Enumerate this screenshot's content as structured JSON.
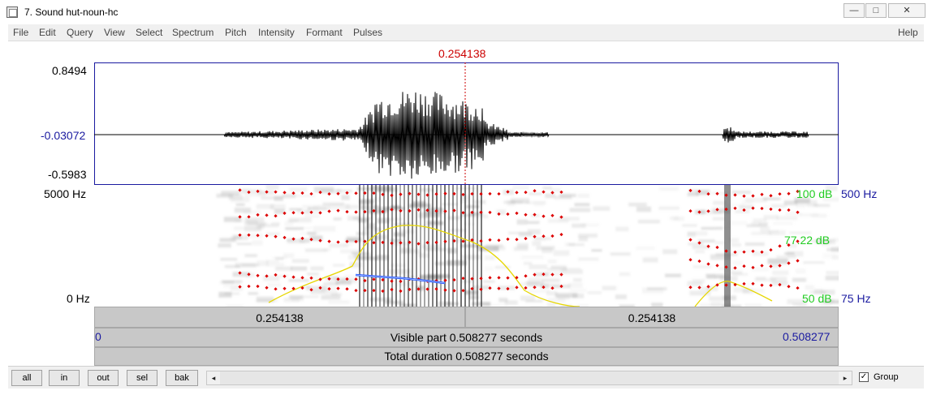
{
  "window": {
    "title": "7. Sound hut-noun-hc",
    "min_glyph": "—",
    "max_glyph": "□",
    "close_glyph": "✕"
  },
  "menu": {
    "items": [
      "File",
      "Edit",
      "Query",
      "View",
      "Select",
      "Spectrum",
      "Pitch",
      "Intensity",
      "Formant",
      "Pulses"
    ],
    "help": "Help"
  },
  "cursor": {
    "time_label": "0.254138",
    "time": 0.254138
  },
  "waveform": {
    "max_label": "0.8494",
    "zero_label": "-0.03072",
    "min_label": "-0.5983"
  },
  "spectrogram": {
    "top_freq_label": "5000 Hz",
    "bottom_freq_label": "0 Hz",
    "intensity_top": "100 dB",
    "intensity_mid": "77.22 dB",
    "intensity_bottom": "50 dB",
    "pitch_top": "500 Hz",
    "pitch_bottom": "75 Hz"
  },
  "time_panel": {
    "left_segment": "0.254138",
    "right_segment": "0.254138",
    "visible_start": "0",
    "visible_text": "Visible part 0.508277 seconds",
    "visible_end": "0.508277",
    "total_text": "Total duration 0.508277 seconds"
  },
  "buttons": {
    "all": "all",
    "in": "in",
    "out": "out",
    "sel": "sel",
    "bak": "bak"
  },
  "group": {
    "label": "Group",
    "checked": true,
    "check_glyph": "✓"
  },
  "scroll": {
    "left_arrow": "◂",
    "right_arrow": "▸"
  },
  "colors": {
    "cursor": "#cc0000",
    "pitch_label": "#1a1aa0",
    "intensity_label": "#22cc22",
    "zero_label": "#1a1aa0",
    "formant": "#dd0000",
    "intensity_curve": "#e6d600",
    "pitch_curve": "#1e50ff"
  }
}
